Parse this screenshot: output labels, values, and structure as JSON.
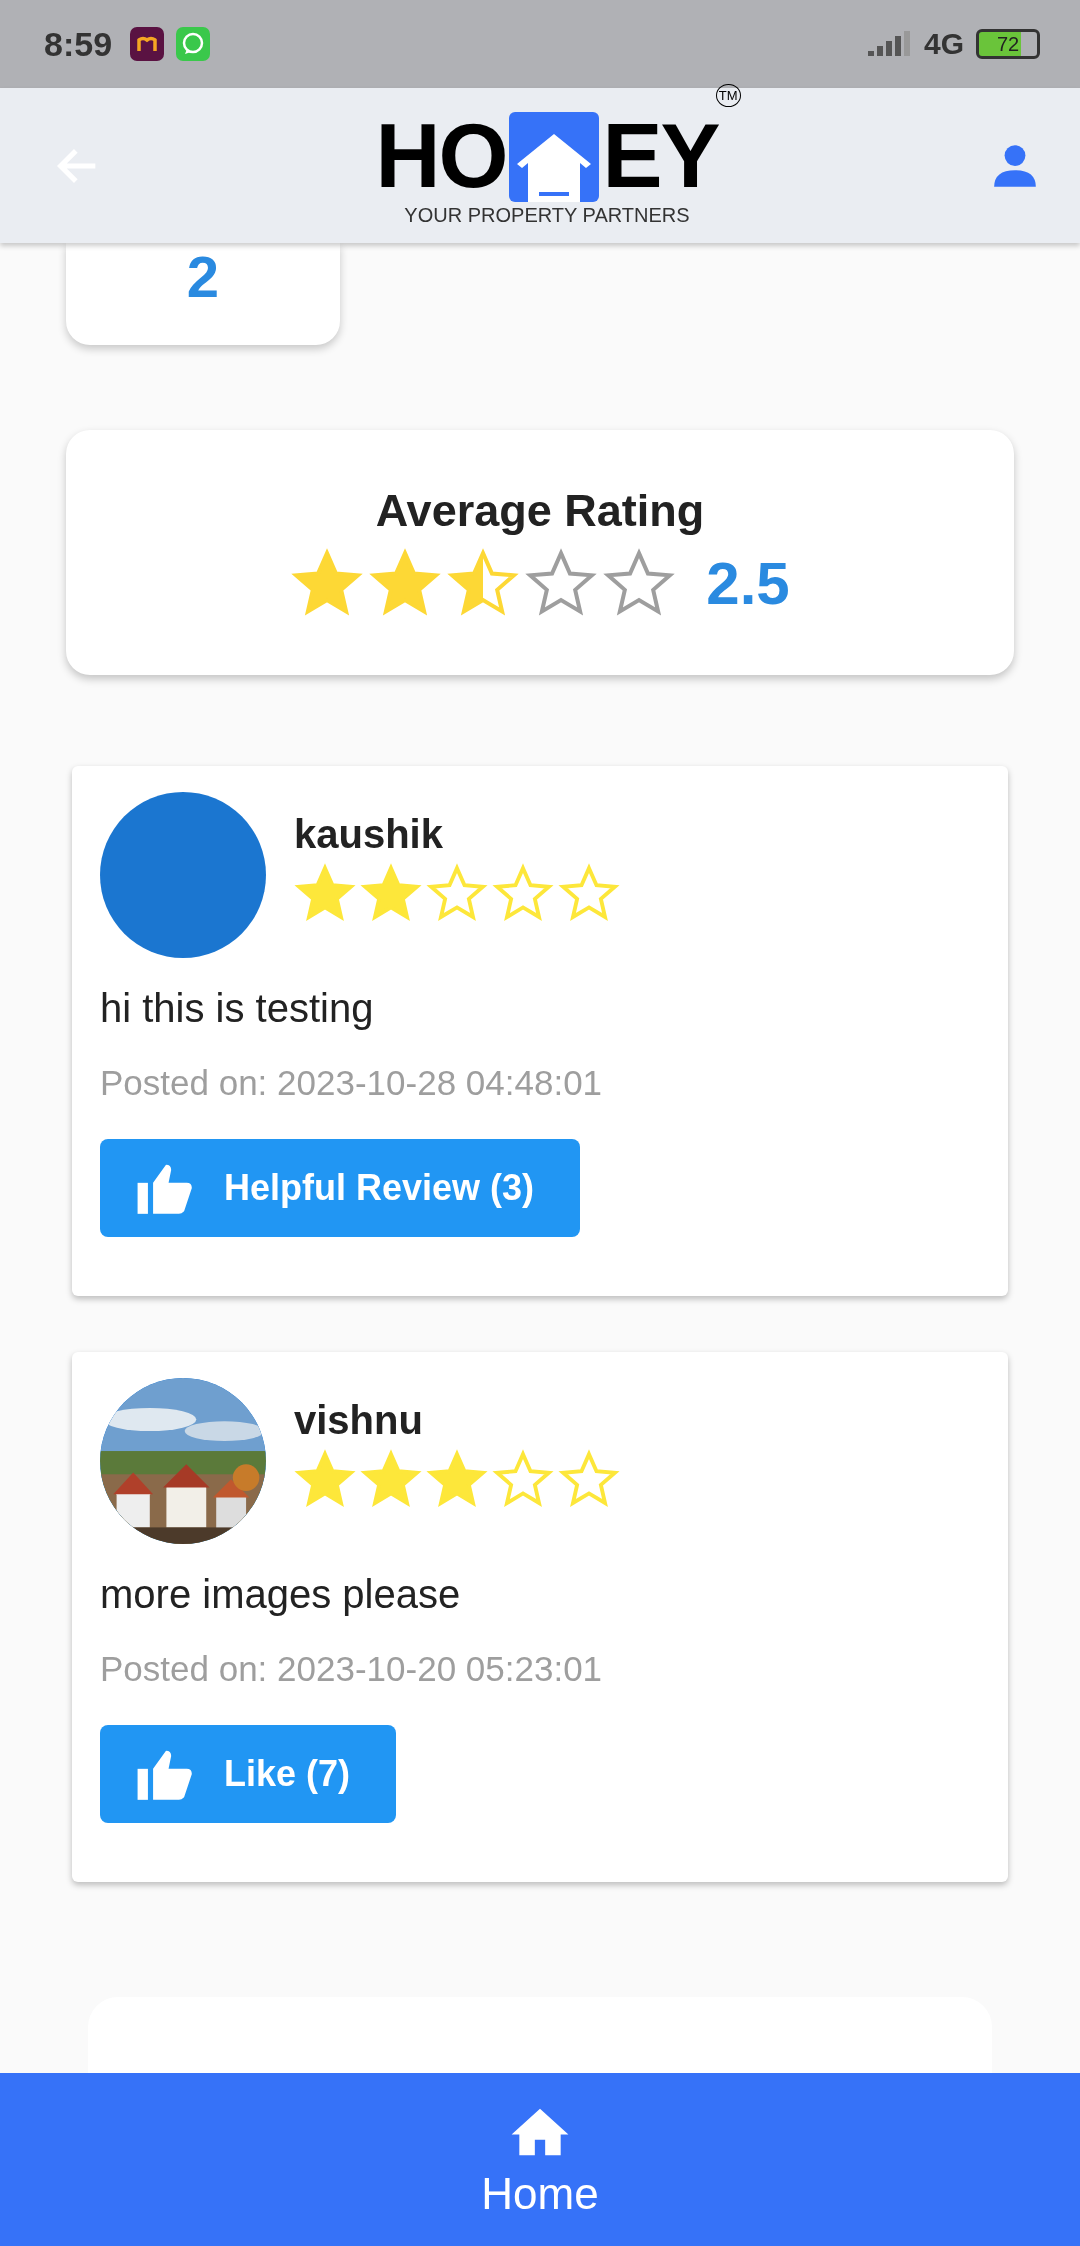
{
  "status_bar": {
    "time": "8:59",
    "network": "4G",
    "battery": "72"
  },
  "header": {
    "logo_left": "HO",
    "logo_right": "EY",
    "trademark": "TM",
    "tagline": "YOUR PROPERTY PARTNERS"
  },
  "count_card": {
    "value": "2"
  },
  "average": {
    "title": "Average Rating",
    "stars": 2.5,
    "value": "2.5"
  },
  "reviews": [
    {
      "name": "kaushik",
      "kind": "plain",
      "stars": 2,
      "text": "hi this is testing",
      "posted": "Posted on: 2023-10-28 04:48:01",
      "button": "Helpful Review (3)"
    },
    {
      "name": "vishnu",
      "kind": "picture",
      "stars": 3,
      "text": "more images please",
      "posted": "Posted on: 2023-10-20 05:23:01",
      "button": "Like (7)"
    }
  ],
  "bottom_nav": {
    "label": "Home"
  }
}
